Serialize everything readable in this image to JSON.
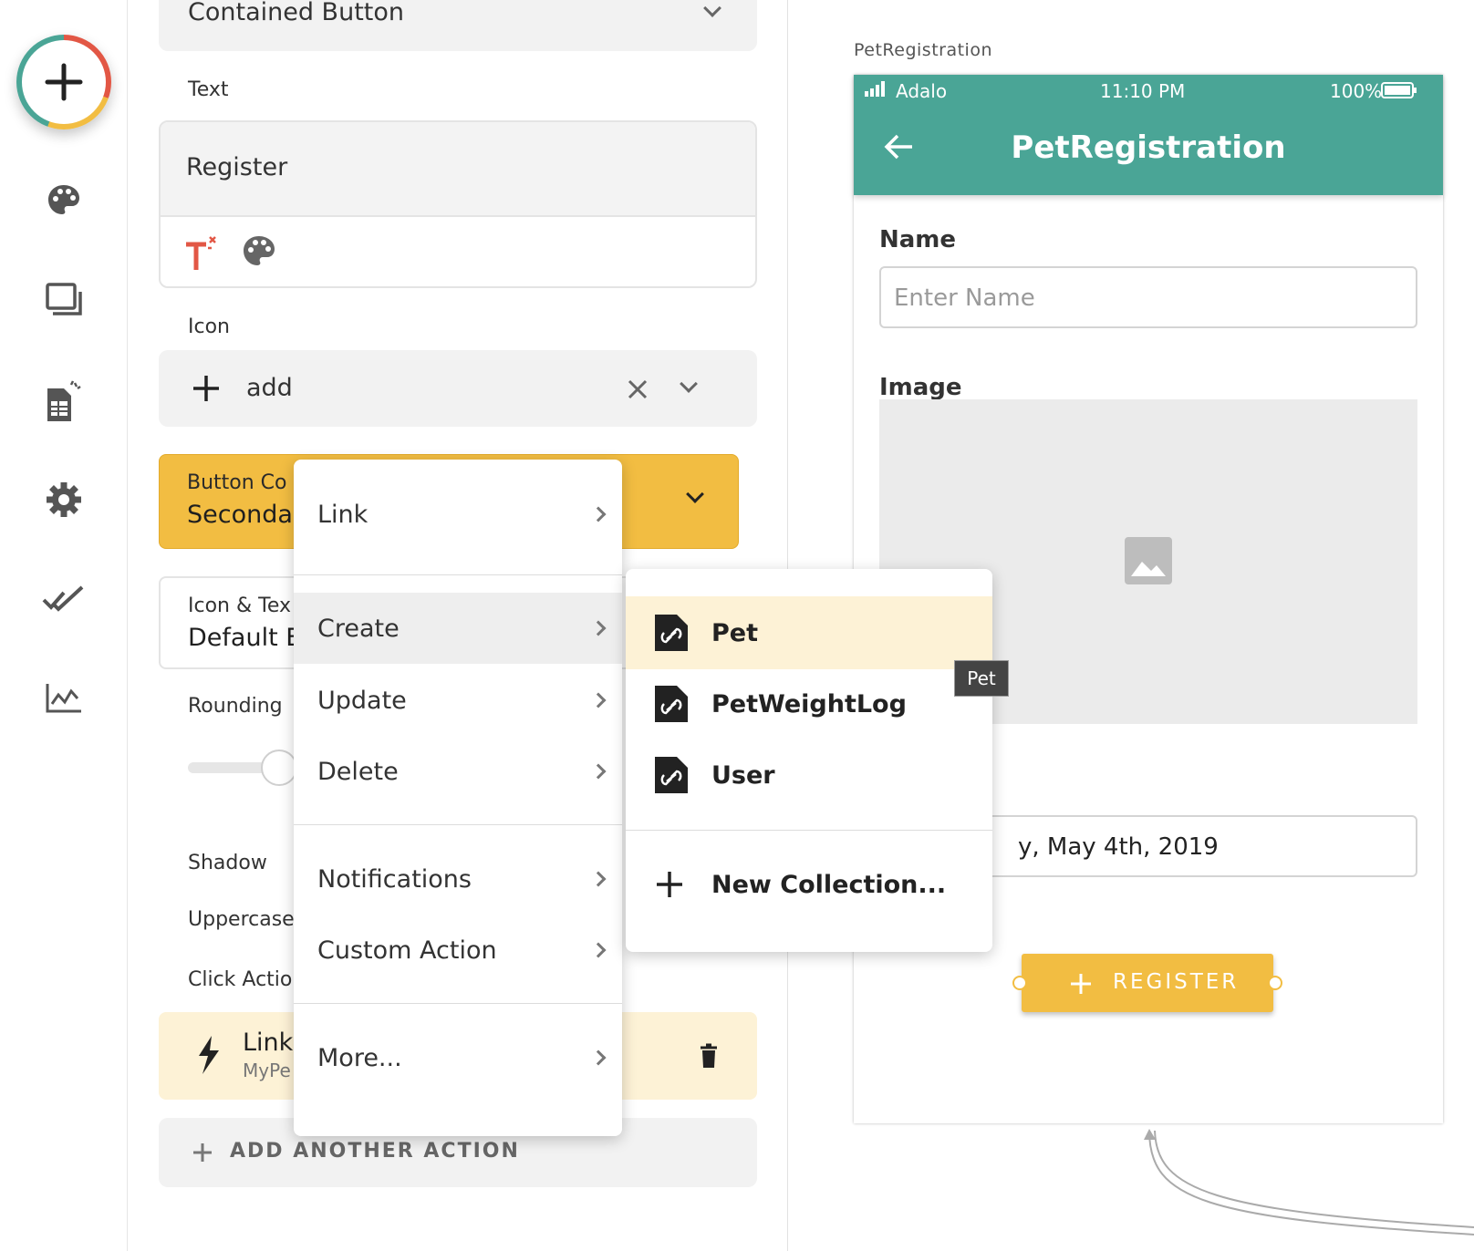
{
  "panel": {
    "button_type": "Contained Button",
    "text_label": "Text",
    "text_value": "Register",
    "icon_label": "Icon",
    "icon_value": "add",
    "button_color_label": "Button Co",
    "button_color_value": "Seconda",
    "icon_text_label": "Icon & Tex",
    "icon_text_value": "Default E",
    "rounding_label": "Rounding",
    "shadow_label": "Shadow",
    "uppercase_label": "Uppercase",
    "click_actions_label": "Click Actio",
    "action_title": "Link",
    "action_sub": "MyPe",
    "add_action": "ADD ANOTHER ACTION"
  },
  "menu": {
    "items": [
      "Link",
      "Create",
      "Update",
      "Delete",
      "Notifications",
      "Custom Action",
      "More..."
    ]
  },
  "submenu": {
    "items": [
      "Pet",
      "PetWeightLog",
      "User"
    ],
    "new_collection": "New Collection..."
  },
  "tooltip": "Pet",
  "canvas": {
    "screen_name": "PetRegistration",
    "status": {
      "carrier": "Adalo",
      "time": "11:10 PM",
      "battery": "100%"
    },
    "title": "PetRegistration",
    "name_label": "Name",
    "name_placeholder": "Enter Name",
    "image_label": "Image",
    "date_value": "y, May 4th, 2019",
    "register_button": "REGISTER"
  },
  "colors": {
    "teal": "#4aa596",
    "yellow": "#f2bd42",
    "highlight": "#fdf2d6"
  }
}
